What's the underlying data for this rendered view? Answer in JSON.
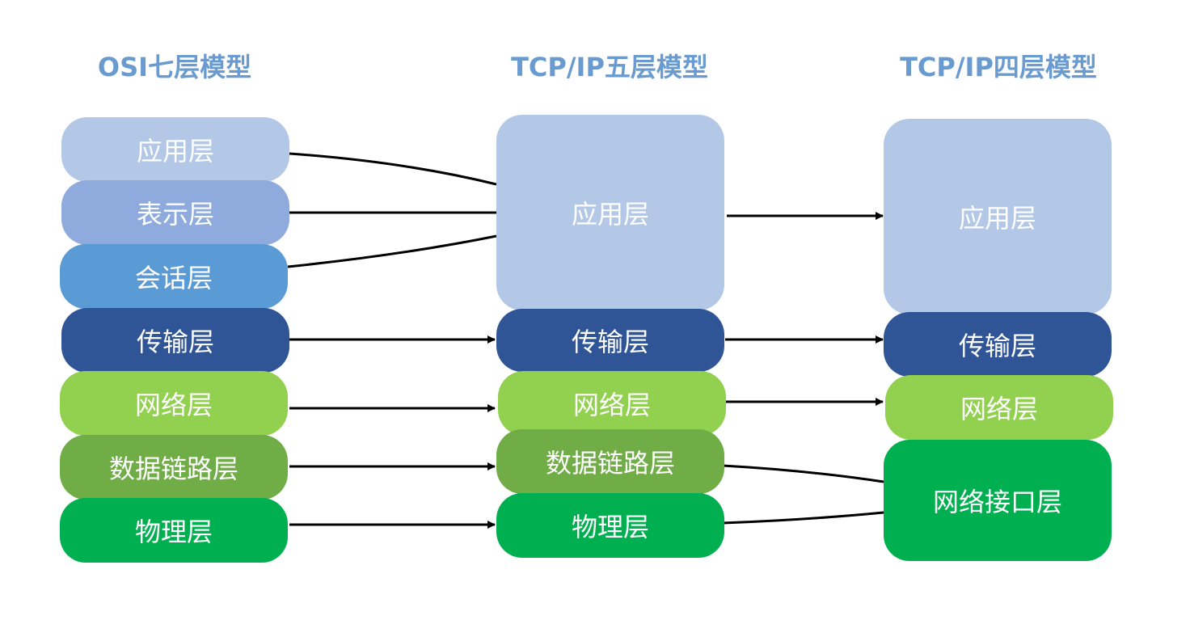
{
  "columns": [
    {
      "title": "OSI七层模型",
      "layers": [
        {
          "label": "应用层",
          "color": "#b3c7e7"
        },
        {
          "label": "表示层",
          "color": "#8faadc"
        },
        {
          "label": "会话层",
          "color": "#5b9bd5"
        },
        {
          "label": "传输层",
          "color": "#2f5597"
        },
        {
          "label": "网络层",
          "color": "#92d050"
        },
        {
          "label": "数据链路层",
          "color": "#70ad47"
        },
        {
          "label": "物理层",
          "color": "#00b050"
        }
      ]
    },
    {
      "title": "TCP/IP五层模型",
      "layers": [
        {
          "label": "应用层",
          "color": "#b3c7e7"
        },
        {
          "label": "传输层",
          "color": "#2f5597"
        },
        {
          "label": "网络层",
          "color": "#92d050"
        },
        {
          "label": "数据链路层",
          "color": "#70ad47"
        },
        {
          "label": "物理层",
          "color": "#00b050"
        }
      ]
    },
    {
      "title": "TCP/IP四层模型",
      "layers": [
        {
          "label": "应用层",
          "color": "#b3c7e7"
        },
        {
          "label": "传输层",
          "color": "#2f5597"
        },
        {
          "label": "网络层",
          "color": "#92d050"
        },
        {
          "label": "网络接口层",
          "color": "#00b050"
        }
      ]
    }
  ],
  "mappings": {
    "osi_to_five": [
      [
        0,
        0
      ],
      [
        1,
        0
      ],
      [
        2,
        0
      ],
      [
        3,
        1
      ],
      [
        4,
        2
      ],
      [
        5,
        3
      ],
      [
        6,
        4
      ]
    ],
    "five_to_four": [
      [
        0,
        0
      ],
      [
        1,
        1
      ],
      [
        2,
        2
      ],
      [
        3,
        3
      ],
      [
        4,
        3
      ]
    ]
  }
}
